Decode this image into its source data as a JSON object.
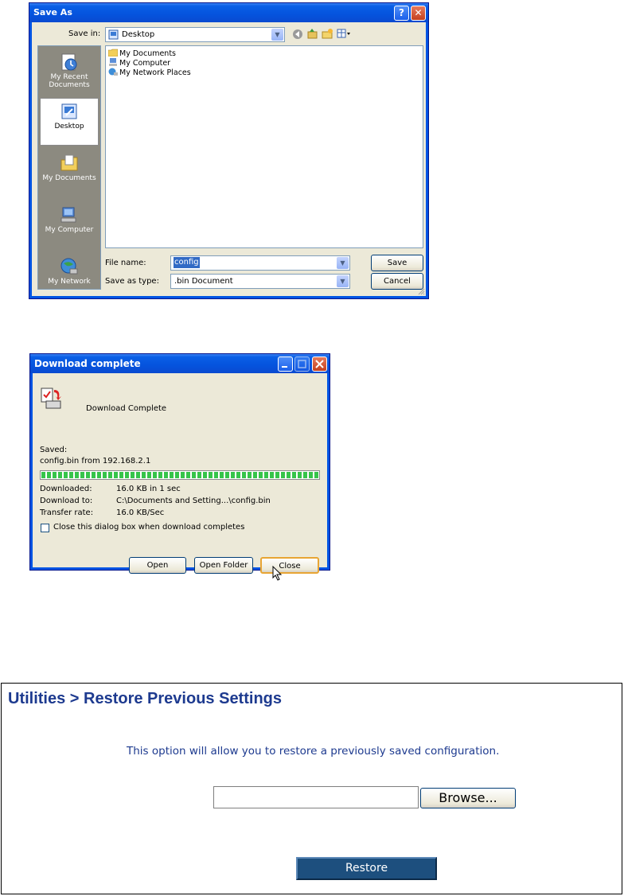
{
  "save_as": {
    "title": "Save As",
    "help_btn": "?",
    "close_btn": "✕",
    "save_in_label": "Save in:",
    "save_in_value": "Desktop",
    "places": [
      "My Recent Documents",
      "Desktop",
      "My Documents",
      "My Computer",
      "My Network"
    ],
    "files": [
      "My Documents",
      "My Computer",
      "My Network Places"
    ],
    "file_name_label": "File name:",
    "file_name_value": "config",
    "save_type_label": "Save as type:",
    "save_type_value": ".bin Document",
    "save_btn": "Save",
    "cancel_btn": "Cancel"
  },
  "download": {
    "title": "Download complete",
    "heading": "Download Complete",
    "saved_label": "Saved:",
    "saved_value": "config.bin from 192.168.2.1",
    "progress": 1.0,
    "downloaded_label": "Downloaded:",
    "downloaded_value": "16.0 KB in 1 sec",
    "download_to_label": "Download to:",
    "download_to_value": "C:\\Documents and Setting...\\config.bin",
    "rate_label": "Transfer rate:",
    "rate_value": "16.0 KB/Sec",
    "close_when_done": "Close this dialog box when download completes",
    "open_btn": "Open",
    "open_folder_btn": "Open Folder",
    "close_btn": "Close"
  },
  "restore": {
    "title": "Utilities > Restore Previous Settings",
    "description": "This option will allow you to restore a previously saved configuration.",
    "file_input_value": "",
    "browse_btn": "Browse...",
    "restore_btn": "Restore"
  }
}
